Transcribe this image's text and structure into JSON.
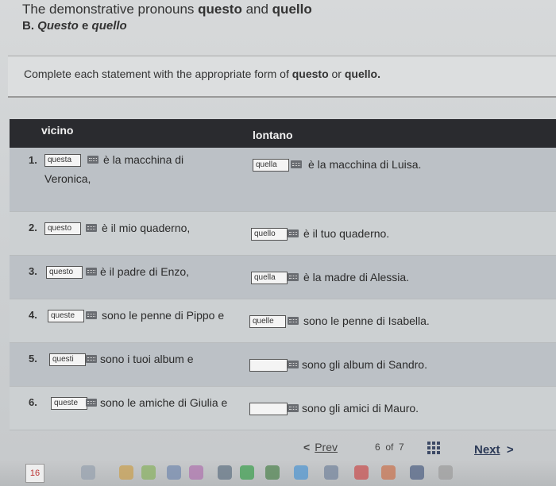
{
  "header": {
    "title_prefix": "The demonstrative pronouns ",
    "title_b1": "questo",
    "title_and": " and ",
    "title_b2": "quello",
    "subtitle_prefix": "B. ",
    "subtitle_i1": "Questo",
    "subtitle_e": " e ",
    "subtitle_i2": "quello"
  },
  "instructions": {
    "prefix": "Complete each statement with the appropriate form of ",
    "b1": "questo",
    "or": " or ",
    "b2": "quello."
  },
  "table": {
    "col_left": "vicino",
    "col_right": "lontano",
    "rows": [
      {
        "num": "1.",
        "left_answer": "questa",
        "left_text": "è la macchina di",
        "left_text2": "Veronica,",
        "right_answer": "quella",
        "right_text": "è la macchina di Luisa."
      },
      {
        "num": "2.",
        "left_answer": "questo",
        "left_text": "è il mio quaderno,",
        "right_answer": "quello",
        "right_text": "è il tuo quaderno."
      },
      {
        "num": "3.",
        "left_answer": "questo",
        "left_text": "è il padre di Enzo,",
        "right_answer": "quella",
        "right_text": "è la madre di Alessia."
      },
      {
        "num": "4.",
        "left_answer": "queste",
        "left_text": "sono le penne di Pippo e",
        "right_answer": "quelle",
        "right_text": "sono le penne di Isabella."
      },
      {
        "num": "5.",
        "left_answer": "questi",
        "left_text": "sono i tuoi album e",
        "right_answer": "",
        "right_text": "sono gli album di Sandro."
      },
      {
        "num": "6.",
        "left_answer": "queste",
        "left_text": "sono le amiche di Giulia e",
        "right_answer": "",
        "right_text": "sono gli amici di Mauro."
      }
    ]
  },
  "nav": {
    "prev_chevron": "<",
    "prev_label": "Prev",
    "page_current": "6",
    "page_of": "of",
    "page_total": "7",
    "next_label": "Next",
    "next_chevron": ">"
  },
  "dock": {
    "calendar_day": "16"
  }
}
